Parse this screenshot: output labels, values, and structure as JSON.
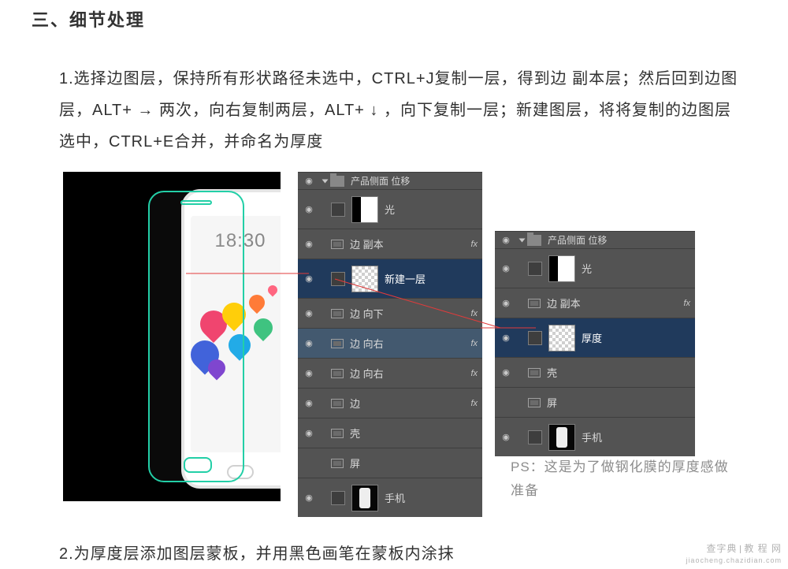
{
  "heading": "三、细节处理",
  "para1": "1.选择边图层，保持所有形状路径未选中，CTRL+J复制一层，得到边 副本层；然后回到边图层，ALT+ → 两次，向右复制两层，ALT+ ↓ ，向下复制一层；新建图层，将将复制的边图层选中，CTRL+E合并，并命名为厚度",
  "phone": {
    "clock": "18:30"
  },
  "panelA": {
    "groupName": "产品侧面 位移",
    "rows": [
      {
        "label": "光",
        "thumb": "halfwhite",
        "fx": false,
        "eye": true,
        "tall": true
      },
      {
        "label": "边 副本",
        "thumb": "shape",
        "fx": true,
        "eye": true
      },
      {
        "label": "新建一层",
        "thumb": "checker",
        "fx": false,
        "eye": true,
        "sel": true,
        "tall": true
      },
      {
        "label": "边 向下",
        "thumb": "shape",
        "fx": true,
        "eye": true
      },
      {
        "label": "边 向右",
        "thumb": "shape",
        "fx": true,
        "eye": true,
        "sel2": true
      },
      {
        "label": "边 向右",
        "thumb": "shape",
        "fx": true,
        "eye": true
      },
      {
        "label": "边",
        "thumb": "shape",
        "fx": true,
        "eye": true
      },
      {
        "label": "壳",
        "thumb": "shape",
        "fx": false,
        "eye": true
      },
      {
        "label": "屏",
        "thumb": "shape",
        "fx": false,
        "eye": false
      },
      {
        "label": "手机",
        "thumb": "phone",
        "fx": false,
        "eye": true,
        "tall": true
      }
    ]
  },
  "panelB": {
    "groupName": "产品侧面 位移",
    "rows": [
      {
        "label": "光",
        "thumb": "halfwhite",
        "eye": true,
        "tall": true
      },
      {
        "label": "边 副本",
        "thumb": "shape",
        "eye": true,
        "fx": true
      },
      {
        "label": "厚度",
        "thumb": "checker",
        "eye": true,
        "sel": true,
        "tall": true
      },
      {
        "label": "壳",
        "thumb": "shape",
        "eye": true
      },
      {
        "label": "屏",
        "thumb": "shape",
        "eye": false
      },
      {
        "label": "手机",
        "thumb": "phone",
        "eye": true,
        "tall": true
      }
    ]
  },
  "note": "PS：这是为了做钢化膜的厚度感做准备",
  "para2": "2.为厚度层添加图层蒙板，并用黑色画笔在蒙板内涂抹",
  "watermark": {
    "name": "查字典",
    "section": "教 程 网",
    "url": "jiaocheng.chazidian.com"
  }
}
